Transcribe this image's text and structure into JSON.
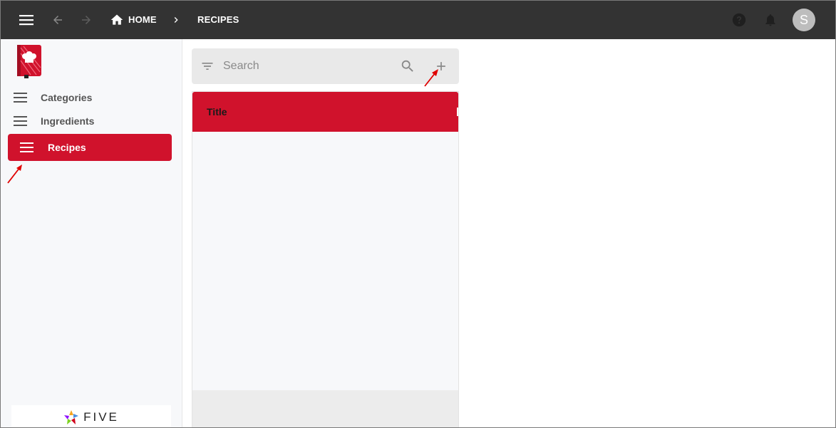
{
  "topbar": {
    "menu_icon": "menu-icon",
    "back_icon": "arrow-back-icon",
    "forward_icon": "arrow-forward-icon",
    "home_icon": "home-icon",
    "home_label": "HOME",
    "separator_icon": "chevron-right-icon",
    "current_label": "RECIPES",
    "help_icon": "help-icon",
    "notifications_icon": "bell-icon",
    "avatar_initial": "S",
    "background_color": "#333333"
  },
  "sidebar": {
    "logo_icon": "recipe-book-logo",
    "items": [
      {
        "label": "Categories",
        "icon": "list-icon",
        "active": false
      },
      {
        "label": "Ingredients",
        "icon": "list-icon",
        "active": false
      },
      {
        "label": "Recipes",
        "icon": "list-icon",
        "active": true
      }
    ],
    "footer_brand": "FIVE",
    "accent_color": "#d0122c"
  },
  "main": {
    "search": {
      "placeholder": "Search",
      "value": ""
    },
    "filter_icon": "filter-icon",
    "search_icon": "search-icon",
    "add_icon": "plus-icon",
    "list": {
      "header_label": "Title",
      "rows": []
    }
  },
  "annotations": {
    "arrow_color": "#e00000"
  }
}
